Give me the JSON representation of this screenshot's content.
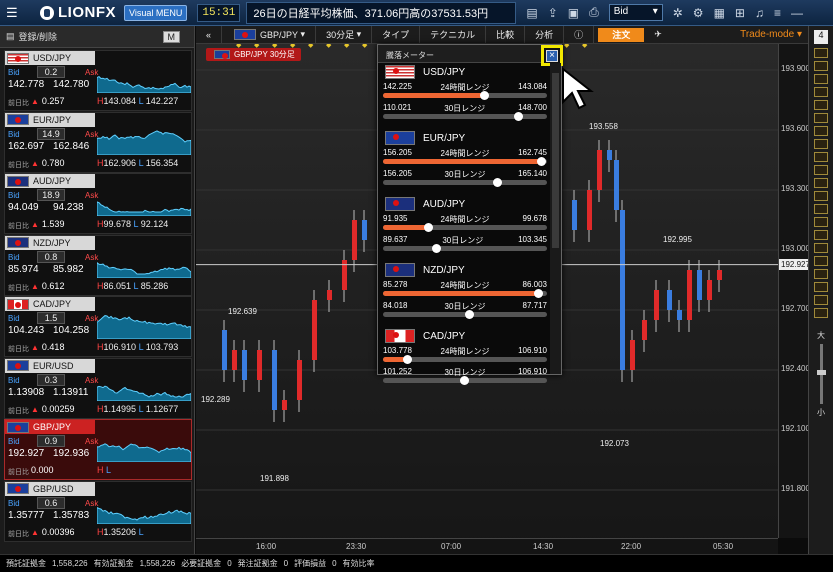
{
  "header": {
    "app_name": "LIONFX",
    "visual_button": "Visual MENU",
    "time": "15:31",
    "news": "26日の日経平均株価、371.06円高の37531.53円",
    "price_type": "Bid"
  },
  "sidebar": {
    "register_label": "登録/削除",
    "mode_button": "M",
    "labels": {
      "bid": "Bid",
      "ask": "Ask",
      "change": "前日比"
    },
    "pairs": [
      {
        "name": "USD/JPY",
        "flag": "us",
        "spread": "0.2",
        "bid": "142.778",
        "ask": "142.780",
        "change": "0.257",
        "dir": "up",
        "high": "143.084",
        "low": "142.227"
      },
      {
        "name": "EUR/JPY",
        "flag": "eu",
        "spread": "14.9",
        "bid": "162.697",
        "ask": "162.846",
        "change": "0.780",
        "dir": "up",
        "high": "162.906",
        "low": "156.354"
      },
      {
        "name": "AUD/JPY",
        "flag": "au",
        "spread": "18.9",
        "bid": "94.049",
        "ask": "94.238",
        "change": "1.539",
        "dir": "up",
        "high": "99.678",
        "low": "92.124"
      },
      {
        "name": "NZD/JPY",
        "flag": "nz",
        "spread": "0.8",
        "bid": "85.974",
        "ask": "85.982",
        "change": "0.612",
        "dir": "up",
        "high": "86.051",
        "low": "85.286"
      },
      {
        "name": "CAD/JPY",
        "flag": "ca",
        "spread": "1.5",
        "bid": "104.243",
        "ask": "104.258",
        "change": "0.418",
        "dir": "up",
        "high": "106.910",
        "low": "103.793"
      },
      {
        "name": "EUR/USD",
        "flag": "eu",
        "spread": "0.3",
        "bid": "1.13908",
        "ask": "1.13911",
        "change": "0.00259",
        "dir": "up",
        "high": "1.14995",
        "low": "1.12677"
      },
      {
        "name": "GBP/JPY",
        "flag": "gb",
        "spread": "0.9",
        "bid": "192.927",
        "ask": "192.936",
        "change": "0.000",
        "dir": "none",
        "high": "",
        "low": ""
      },
      {
        "name": "GBP/USD",
        "flag": "gb",
        "spread": "0.6",
        "bid": "1.35777",
        "ask": "1.35783",
        "change": "0.00396",
        "dir": "up",
        "high": "1.35206",
        "low": ""
      }
    ]
  },
  "chart_toolbar": {
    "pair": "GBP/JPY",
    "period": "30分足",
    "type": "タイプ",
    "technical": "テクニカル",
    "compare": "比較",
    "analysis": "分析",
    "order": "注文",
    "trade_mode": "Trade-mode"
  },
  "chart": {
    "label": "GBP/JPY 30分足",
    "y_ticks": [
      "193.900",
      "193.600",
      "193.300",
      "193.000",
      "192.700",
      "192.400",
      "192.100",
      "191.800"
    ],
    "x_ticks": [
      "16:00",
      "23:30",
      "07:00",
      "14:30",
      "22:00",
      "05:30"
    ],
    "current_price": "192.927",
    "annotations": [
      "193.558",
      "192.995",
      "192.639",
      "192.289",
      "192.073",
      "191.898"
    ],
    "zoom_in": "大",
    "zoom_out": "小"
  },
  "meter": {
    "title": "騰落メーター",
    "range24": "24時間レンジ",
    "range30": "30日レンジ",
    "rows": [
      {
        "name": "USD/JPY",
        "flag": "us",
        "lo24": "142.225",
        "hi24": "143.084",
        "pos24": 0.62,
        "lo30": "110.021",
        "hi30": "148.700",
        "pos30": 0.83
      },
      {
        "name": "EUR/JPY",
        "flag": "eu",
        "lo24": "156.205",
        "hi24": "162.745",
        "pos24": 0.97,
        "lo30": "156.205",
        "hi30": "165.140",
        "pos30": 0.7
      },
      {
        "name": "AUD/JPY",
        "flag": "au",
        "lo24": "91.935",
        "hi24": "99.678",
        "pos24": 0.28,
        "lo30": "89.637",
        "hi30": "103.345",
        "pos30": 0.33
      },
      {
        "name": "NZD/JPY",
        "flag": "nz",
        "lo24": "85.278",
        "hi24": "86.003",
        "pos24": 0.95,
        "lo30": "84.018",
        "hi30": "87.717",
        "pos30": 0.53
      },
      {
        "name": "CAD/JPY",
        "flag": "ca",
        "lo24": "103.778",
        "hi24": "106.910",
        "pos24": 0.15,
        "lo30": "101.252",
        "hi30": "106.910",
        "pos30": 0.5
      }
    ]
  },
  "status": {
    "deposit_label": "預託証拠金",
    "deposit": "1,558,226",
    "effective_label": "有効証拠金",
    "effective": "1,558,226",
    "required_label": "必要証拠金",
    "required": "0",
    "order_label": "発注証拠金",
    "order": "0",
    "pl_label": "評価損益",
    "pl": "0",
    "ratio_label": "有効比率"
  }
}
